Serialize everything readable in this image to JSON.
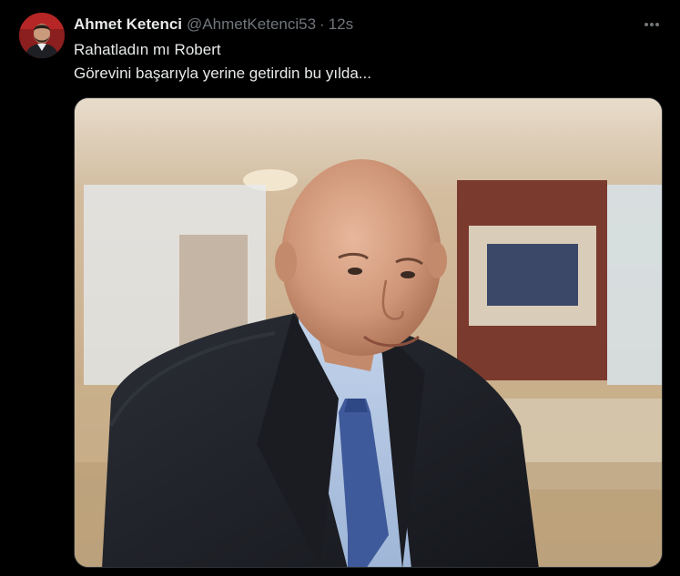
{
  "tweet": {
    "author": {
      "display_name": "Ahmet Ketenci",
      "handle": "@AhmetKetenci53",
      "avatar_icon": "user-avatar"
    },
    "separator": "·",
    "time": "12s",
    "text_lines": [
      "Rahatladın mı Robert",
      "Görevini başarıyla yerine getirdin bu yılda..."
    ],
    "more_icon": "more-horizontal-icon",
    "media": {
      "type": "photo"
    }
  },
  "colors": {
    "background": "#000000",
    "primary_text": "#e7e9ea",
    "secondary_text": "#71767b",
    "border": "#2f3336"
  }
}
